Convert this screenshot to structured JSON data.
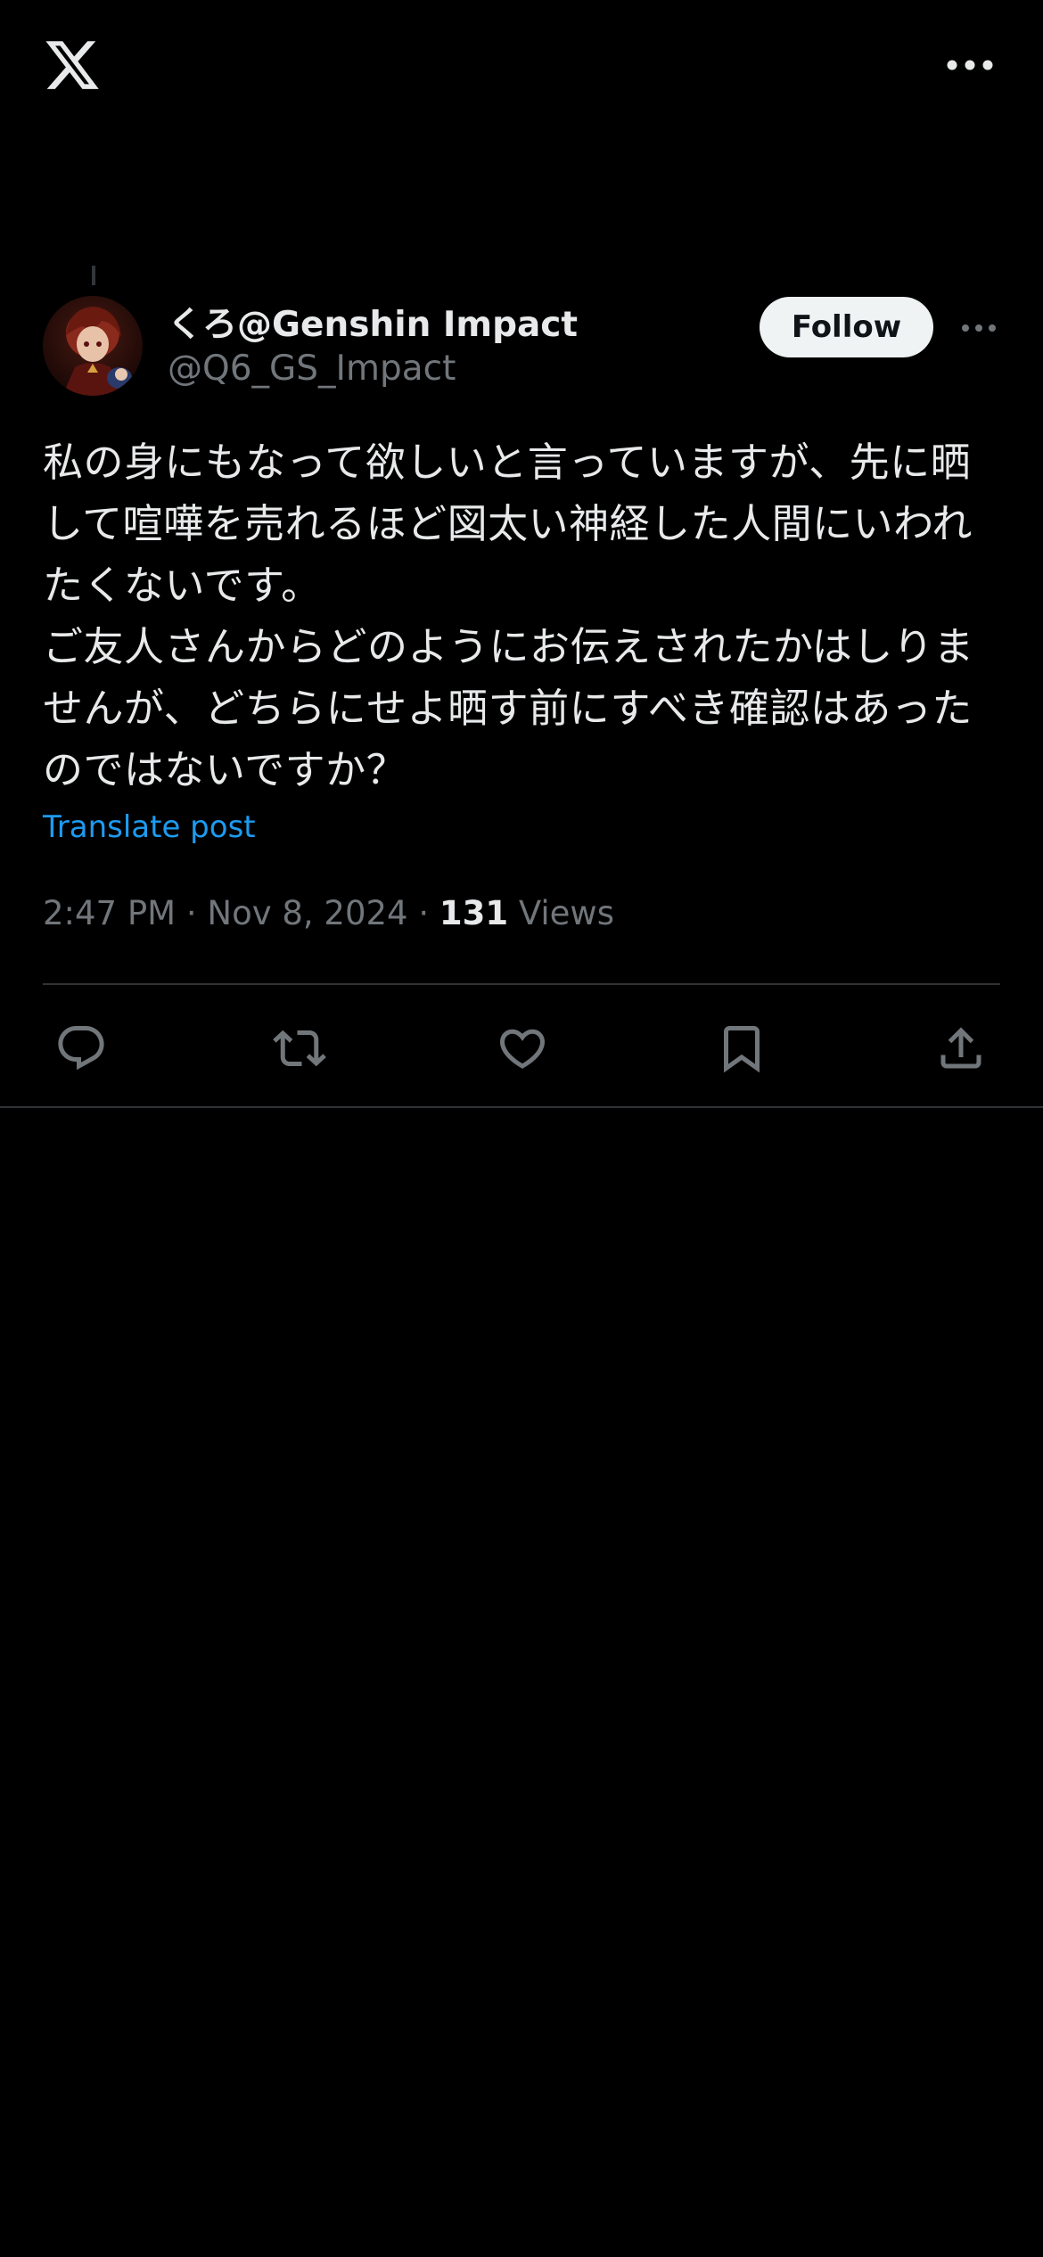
{
  "header": {
    "logo_icon": "x-logo-icon",
    "more_icon": "more-horizontal-icon"
  },
  "post": {
    "author": {
      "display_name": "くろ@Genshin Impact",
      "handle": "@Q6_GS_Impact",
      "avatar_icon": "avatar-image"
    },
    "follow_label": "Follow",
    "text": "私の身にもなって欲しいと言っていますが、先に晒して喧嘩を売れるほど図太い神経した人間にいわれたくないです。\nご友人さんからどのようにお伝えされたかはしりませんが、どちらにせよ晒す前にすべき確認はあったのではないですか？",
    "translate_label": "Translate post",
    "time": "2:47 PM",
    "separator": "·",
    "date": "Nov 8, 2024",
    "views_count": "131",
    "views_label": "Views"
  },
  "actions": [
    {
      "name": "reply",
      "icon": "reply-icon"
    },
    {
      "name": "repost",
      "icon": "repost-icon"
    },
    {
      "name": "like",
      "icon": "heart-icon"
    },
    {
      "name": "bookmark",
      "icon": "bookmark-icon"
    },
    {
      "name": "share",
      "icon": "share-icon"
    }
  ],
  "colors": {
    "background": "#000000",
    "text_primary": "#e7e9ea",
    "text_secondary": "#71767b",
    "accent": "#1d9bf0",
    "divider": "#2f3336",
    "follow_bg": "#eff3f4"
  }
}
